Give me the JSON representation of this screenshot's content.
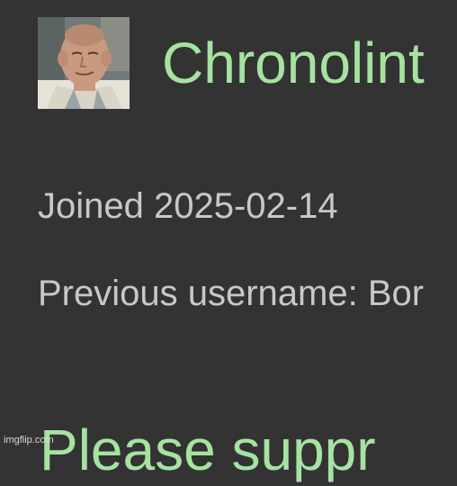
{
  "profile": {
    "username": "Chronolint",
    "joined": "Joined 2025-02-14",
    "previous_username": "Previous username: Bor",
    "support_text": "Please suppr",
    "avatar_icon": "user-avatar-photo"
  },
  "watermark": "imgflip.com",
  "colors": {
    "background": "#333333",
    "accent": "#a6e3a1",
    "text": "#c8c8c8"
  }
}
